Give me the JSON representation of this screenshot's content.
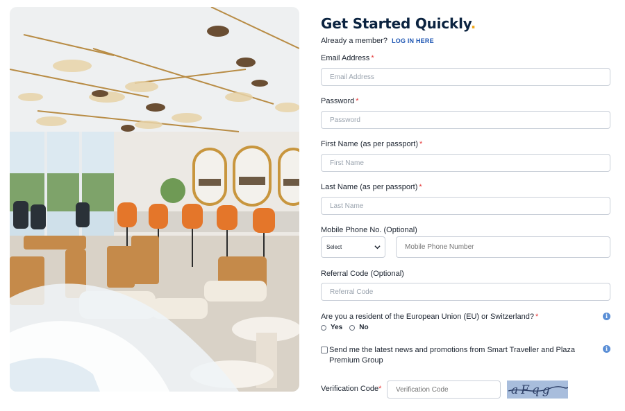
{
  "hero": {
    "alt": "Lounge interior"
  },
  "form": {
    "title": "Get Started Quickly",
    "title_dot": ".",
    "already_member": "Already a member?",
    "login_link": "LOG IN HERE",
    "required_mark": "*",
    "email": {
      "label": "Email Address",
      "placeholder": "Email Address"
    },
    "password": {
      "label": "Password",
      "placeholder": "Password"
    },
    "first_name": {
      "label": "First Name (as per passport)",
      "placeholder": "First Name"
    },
    "last_name": {
      "label": "Last Name (as per passport)",
      "placeholder": "Last Name"
    },
    "mobile": {
      "label": "Mobile Phone No. (Optional)",
      "select_value": "Select",
      "placeholder": "Mobile Phone Number"
    },
    "referral": {
      "label": "Referral Code (Optional)",
      "placeholder": "Referral Code"
    },
    "resident": {
      "question": "Are you a resident of the European Union (EU) or Switzerland?",
      "yes": "Yes",
      "no": "No"
    },
    "news": {
      "text": "Send me the latest news and promotions from Smart Traveller and Plaza Premium Group"
    },
    "verification": {
      "label": "Verification Code",
      "placeholder": "Verification Code",
      "captcha_text": "aFqg"
    },
    "info_icon": "i"
  },
  "colors": {
    "brand_navy": "#0b2340",
    "accent": "#f0a81e",
    "link": "#1e56b3",
    "required": "#e53b3b",
    "info": "#5b8fd6"
  }
}
